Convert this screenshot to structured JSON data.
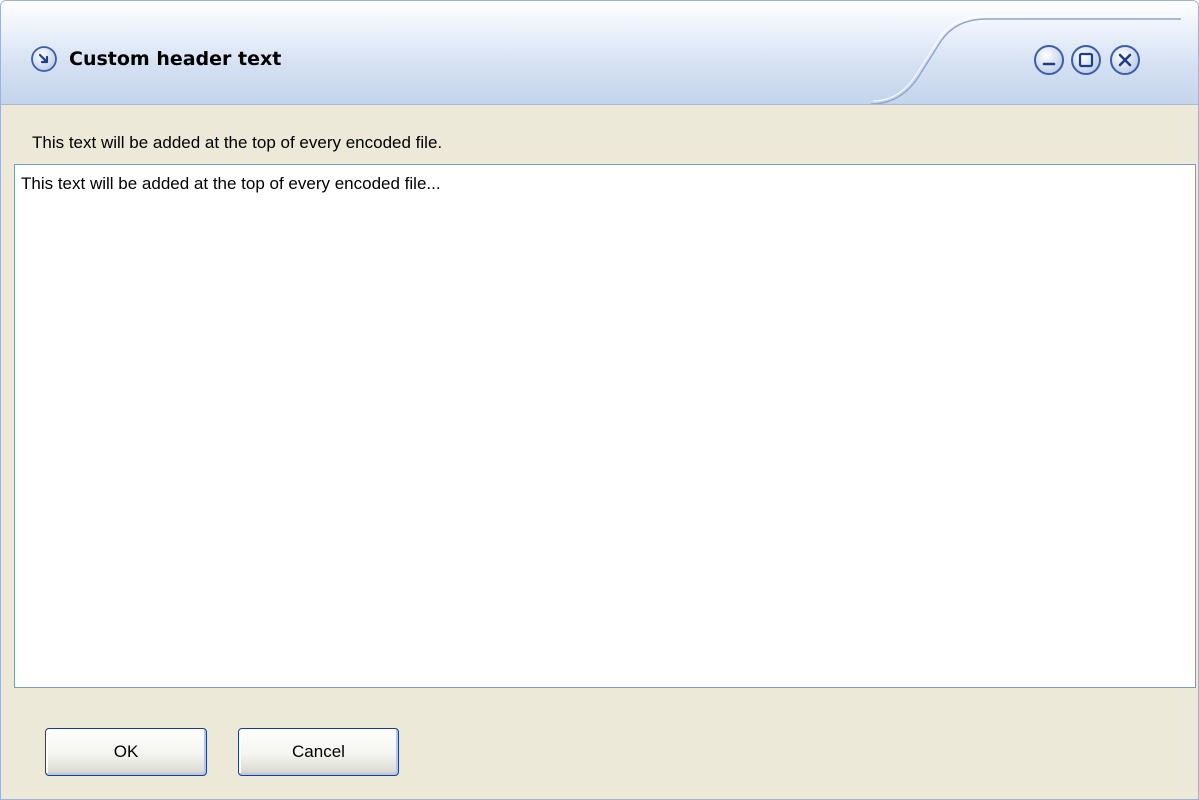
{
  "window": {
    "title": "Custom header text"
  },
  "title_controls": {
    "icon": "arrow-icon",
    "minimize": "minimize-icon",
    "maximize": "maximize-icon",
    "close": "close-icon"
  },
  "body": {
    "description": "This text will be added at the top of every encoded file.",
    "editor_value": "This text will be added at the top of every encoded file..."
  },
  "buttons": {
    "ok_label": "OK",
    "cancel_label": "Cancel"
  },
  "colors": {
    "title_gradient_top": "#fdfeff",
    "title_gradient_bottom": "#c4d4ec",
    "dialog_background": "#ece9d8",
    "button_border": "#1c3c8c"
  }
}
